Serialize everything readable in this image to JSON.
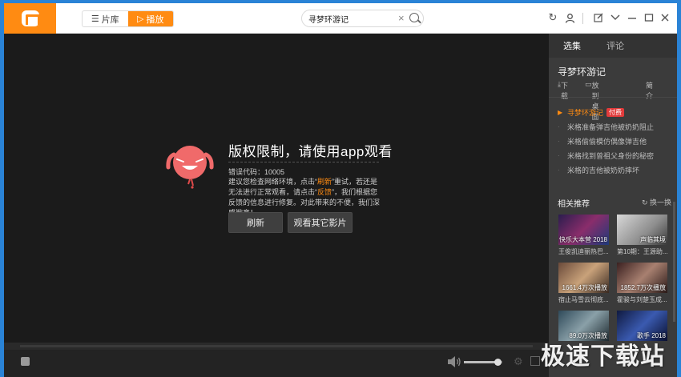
{
  "header": {
    "nav_library": "片库",
    "nav_play": "播放",
    "search_value": "寻梦环游记"
  },
  "player": {
    "message_title": "版权限制，请使用app观看",
    "error_code": "错误代码：10005",
    "desc_1": "建议您检查网络环境，点击“",
    "desc_refresh": "刷新",
    "desc_2": "”重试，若还是无法进行正常观看，请点击“",
    "desc_feedback": "反馈",
    "desc_3": "”，我们根据您反馈的信息进行修复。对此带来的不便，我们深感歉意！",
    "refresh_button": "刷新",
    "other_button": "观看其它影片",
    "volume_level": 0.88
  },
  "sidebar": {
    "tab_episodes": "选集",
    "tab_comments": "评论",
    "title": "寻梦环游记",
    "download": "下载",
    "desktop": "放到桌面",
    "intro": "简介",
    "episodes": [
      {
        "label": "寻梦环游记",
        "badge": "付费",
        "current": true
      },
      {
        "label": "米格准备弹吉他被奶奶阻止"
      },
      {
        "label": "米格偷偷模仿偶像弹吉他"
      },
      {
        "label": "米格找到曾祖父身份的秘密"
      },
      {
        "label": "米格的吉他被奶奶摔坏"
      }
    ],
    "related_title": "相关推荐",
    "related_refresh": "换一换",
    "related": [
      {
        "caption": "快乐大本营 2018",
        "label": "王俊凯迪丽热巴..."
      },
      {
        "caption": "声临其境",
        "label": "第10期：王源助..."
      },
      {
        "caption": "1661.4万次播放",
        "label": "宿止马雪云彻底..."
      },
      {
        "caption": "1852.7万次播放",
        "label": "霍骏与刘楚玉成..."
      },
      {
        "caption": "89.0万次播放",
        "label": ""
      },
      {
        "caption": "歌手 2018",
        "label": ""
      }
    ]
  },
  "watermark": "极速下载站"
}
